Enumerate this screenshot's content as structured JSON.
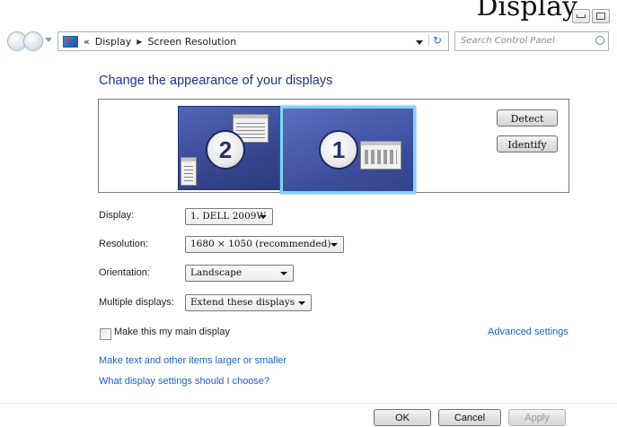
{
  "title_fragment": "Display",
  "window_buttons": {
    "minimize": "minimize",
    "maximize": "maximize"
  },
  "address_bar": {
    "chevron": "«",
    "crumbs": [
      "Display",
      "Screen Resolution"
    ]
  },
  "search": {
    "placeholder": "Search Control Panel"
  },
  "page_title": "Change the appearance of your displays",
  "monitors": [
    {
      "number": "2",
      "selected": false
    },
    {
      "number": "1",
      "selected": true
    }
  ],
  "buttons": {
    "detect": "Detect",
    "identify": "Identify",
    "ok": "OK",
    "cancel": "Cancel",
    "apply": "Apply"
  },
  "fields": {
    "display": {
      "label": "Display:",
      "value": "1. DELL 2009W"
    },
    "resolution": {
      "label": "Resolution:",
      "value": "1680 × 1050 (recommended)"
    },
    "orientation": {
      "label": "Orientation:",
      "value": "Landscape"
    },
    "multiple": {
      "label": "Multiple displays:",
      "value": "Extend these displays"
    }
  },
  "main_display_checkbox": {
    "label": "Make this my main display",
    "checked": false
  },
  "links": {
    "advanced": "Advanced settings",
    "text_size": "Make text and other items larger or smaller",
    "which_settings": "What display settings should I choose?"
  },
  "colors": {
    "title_blue": "#1e3287",
    "link_blue": "#1b63c4",
    "selected_border": "#7fd4f4",
    "monitor_fill": "#3b4c9a"
  }
}
